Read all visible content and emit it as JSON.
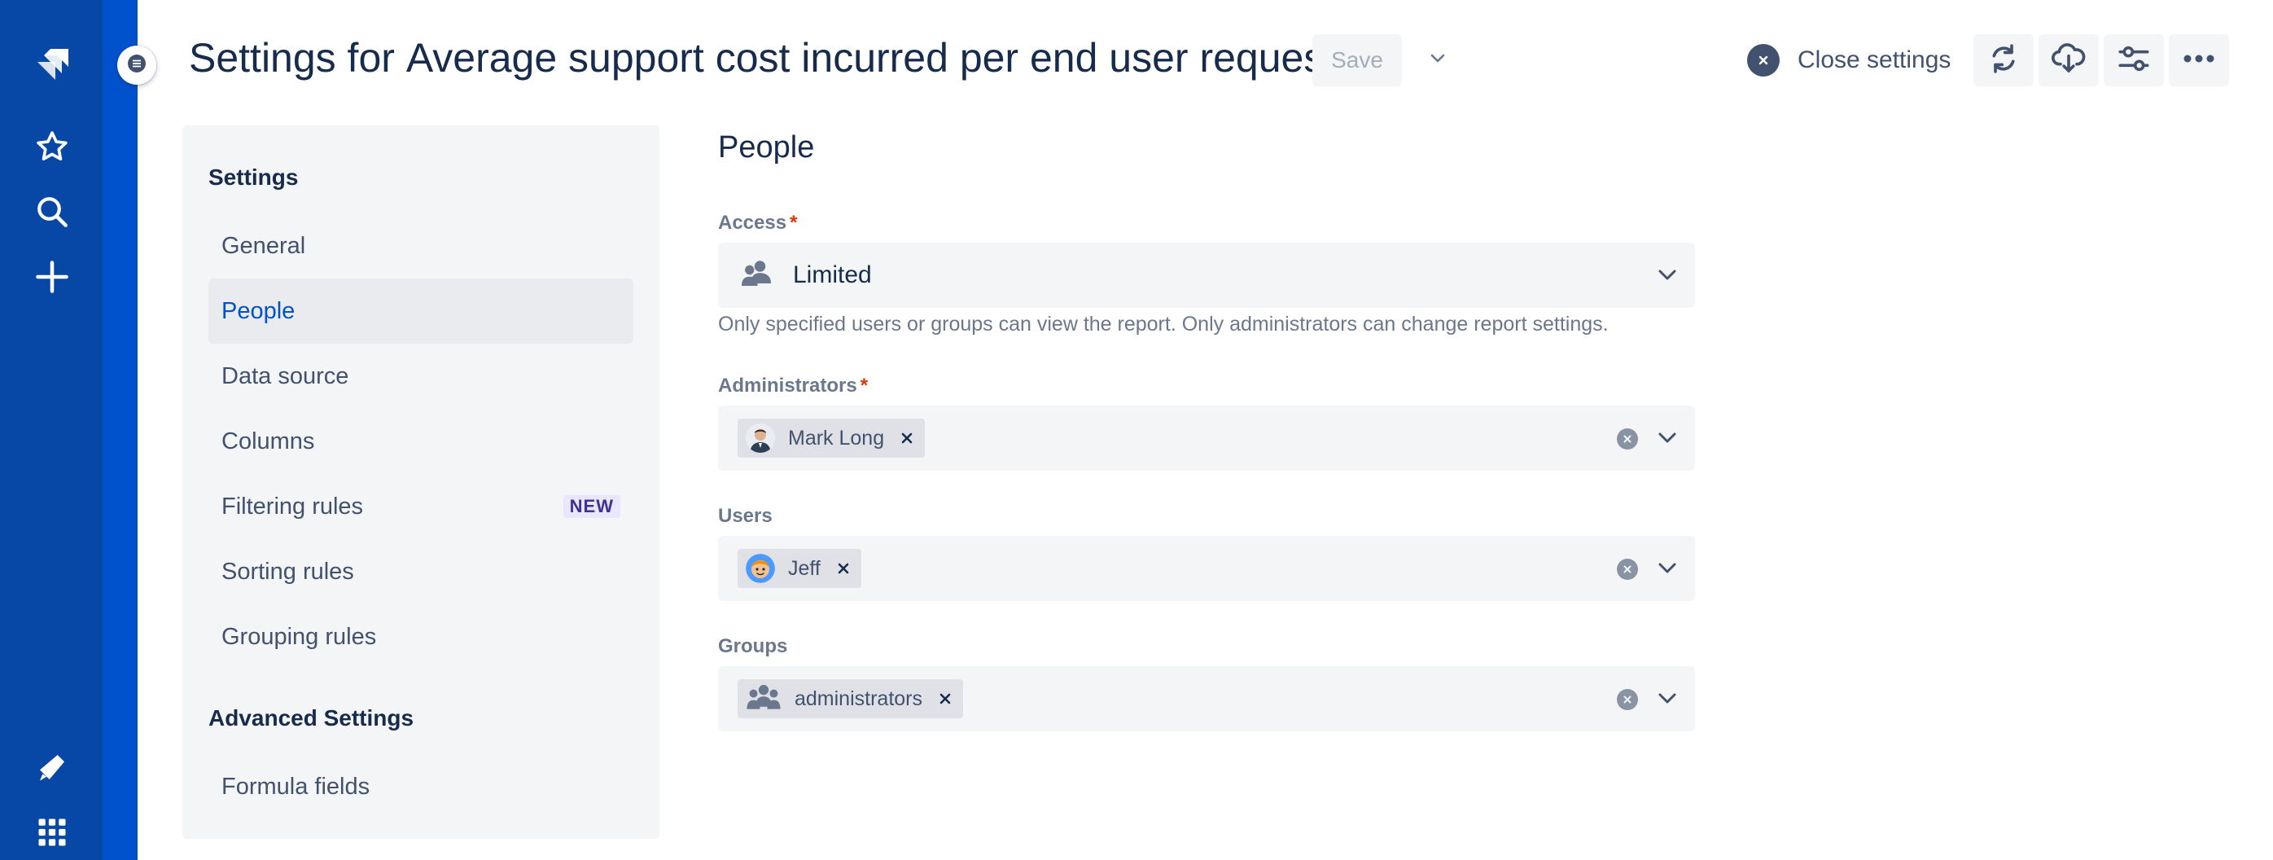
{
  "header": {
    "title_prefix": "Settings for",
    "report_name": "Average support cost incurred per end user request!",
    "save_label": "Save",
    "close_label": "Close settings"
  },
  "sidebar": {
    "heading": "Settings",
    "items": [
      {
        "label": "General"
      },
      {
        "label": "People"
      },
      {
        "label": "Data source"
      },
      {
        "label": "Columns"
      },
      {
        "label": "Filtering rules",
        "badge": "NEW"
      },
      {
        "label": "Sorting rules"
      },
      {
        "label": "Grouping rules"
      }
    ],
    "advanced_heading": "Advanced Settings",
    "advanced_items": [
      {
        "label": "Formula fields"
      }
    ],
    "active": "People"
  },
  "form": {
    "section_title": "People",
    "access": {
      "label": "Access",
      "required_mark": "*",
      "value": "Limited",
      "helper": "Only specified users or groups can view the report. Only administrators can change report settings."
    },
    "administrators": {
      "label": "Administrators",
      "required_mark": "*",
      "chips": [
        "Mark Long"
      ]
    },
    "users": {
      "label": "Users",
      "chips": [
        "Jeff"
      ]
    },
    "groups": {
      "label": "Groups",
      "chips": [
        "administrators"
      ]
    }
  },
  "colors": {
    "nav_bg": "#0747a6",
    "strip_bg": "#0052cc",
    "active_text": "#0052cc",
    "required": "#de350b",
    "badge_bg": "#eae6ff",
    "badge_text": "#403294"
  },
  "icons": {
    "nav": [
      "jira-logo-icon",
      "star-icon",
      "search-icon",
      "plus-icon",
      "megaphone-icon",
      "app-grid-icon"
    ],
    "toolbar": [
      "refresh-icon",
      "cloud-download-icon",
      "sliders-icon",
      "more-icon"
    ]
  }
}
